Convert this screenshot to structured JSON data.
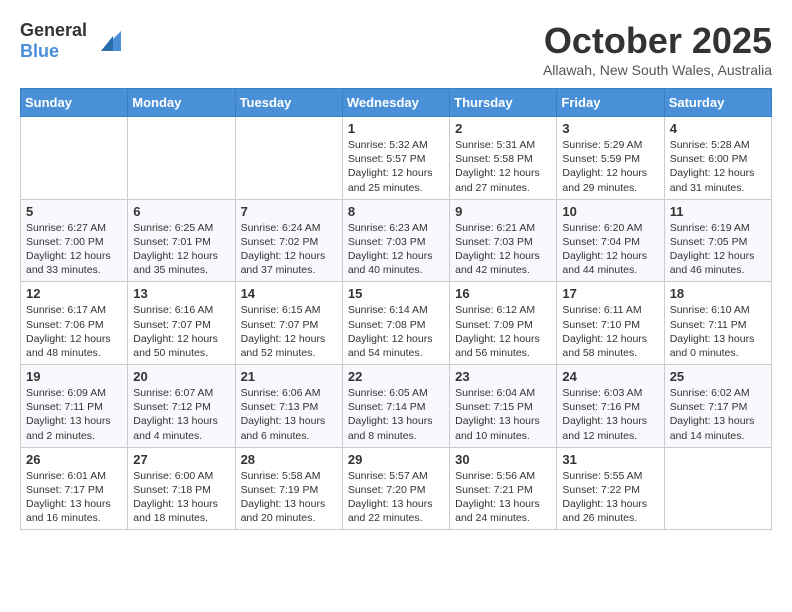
{
  "header": {
    "logo": {
      "text_general": "General",
      "text_blue": "Blue"
    },
    "title": "October 2025",
    "subtitle": "Allawah, New South Wales, Australia"
  },
  "calendar": {
    "weekdays": [
      "Sunday",
      "Monday",
      "Tuesday",
      "Wednesday",
      "Thursday",
      "Friday",
      "Saturday"
    ],
    "weeks": [
      [
        {
          "day": "",
          "info": ""
        },
        {
          "day": "",
          "info": ""
        },
        {
          "day": "",
          "info": ""
        },
        {
          "day": "1",
          "info": "Sunrise: 5:32 AM\nSunset: 5:57 PM\nDaylight: 12 hours\nand 25 minutes."
        },
        {
          "day": "2",
          "info": "Sunrise: 5:31 AM\nSunset: 5:58 PM\nDaylight: 12 hours\nand 27 minutes."
        },
        {
          "day": "3",
          "info": "Sunrise: 5:29 AM\nSunset: 5:59 PM\nDaylight: 12 hours\nand 29 minutes."
        },
        {
          "day": "4",
          "info": "Sunrise: 5:28 AM\nSunset: 6:00 PM\nDaylight: 12 hours\nand 31 minutes."
        }
      ],
      [
        {
          "day": "5",
          "info": "Sunrise: 6:27 AM\nSunset: 7:00 PM\nDaylight: 12 hours\nand 33 minutes."
        },
        {
          "day": "6",
          "info": "Sunrise: 6:25 AM\nSunset: 7:01 PM\nDaylight: 12 hours\nand 35 minutes."
        },
        {
          "day": "7",
          "info": "Sunrise: 6:24 AM\nSunset: 7:02 PM\nDaylight: 12 hours\nand 37 minutes."
        },
        {
          "day": "8",
          "info": "Sunrise: 6:23 AM\nSunset: 7:03 PM\nDaylight: 12 hours\nand 40 minutes."
        },
        {
          "day": "9",
          "info": "Sunrise: 6:21 AM\nSunset: 7:03 PM\nDaylight: 12 hours\nand 42 minutes."
        },
        {
          "day": "10",
          "info": "Sunrise: 6:20 AM\nSunset: 7:04 PM\nDaylight: 12 hours\nand 44 minutes."
        },
        {
          "day": "11",
          "info": "Sunrise: 6:19 AM\nSunset: 7:05 PM\nDaylight: 12 hours\nand 46 minutes."
        }
      ],
      [
        {
          "day": "12",
          "info": "Sunrise: 6:17 AM\nSunset: 7:06 PM\nDaylight: 12 hours\nand 48 minutes."
        },
        {
          "day": "13",
          "info": "Sunrise: 6:16 AM\nSunset: 7:07 PM\nDaylight: 12 hours\nand 50 minutes."
        },
        {
          "day": "14",
          "info": "Sunrise: 6:15 AM\nSunset: 7:07 PM\nDaylight: 12 hours\nand 52 minutes."
        },
        {
          "day": "15",
          "info": "Sunrise: 6:14 AM\nSunset: 7:08 PM\nDaylight: 12 hours\nand 54 minutes."
        },
        {
          "day": "16",
          "info": "Sunrise: 6:12 AM\nSunset: 7:09 PM\nDaylight: 12 hours\nand 56 minutes."
        },
        {
          "day": "17",
          "info": "Sunrise: 6:11 AM\nSunset: 7:10 PM\nDaylight: 12 hours\nand 58 minutes."
        },
        {
          "day": "18",
          "info": "Sunrise: 6:10 AM\nSunset: 7:11 PM\nDaylight: 13 hours\nand 0 minutes."
        }
      ],
      [
        {
          "day": "19",
          "info": "Sunrise: 6:09 AM\nSunset: 7:11 PM\nDaylight: 13 hours\nand 2 minutes."
        },
        {
          "day": "20",
          "info": "Sunrise: 6:07 AM\nSunset: 7:12 PM\nDaylight: 13 hours\nand 4 minutes."
        },
        {
          "day": "21",
          "info": "Sunrise: 6:06 AM\nSunset: 7:13 PM\nDaylight: 13 hours\nand 6 minutes."
        },
        {
          "day": "22",
          "info": "Sunrise: 6:05 AM\nSunset: 7:14 PM\nDaylight: 13 hours\nand 8 minutes."
        },
        {
          "day": "23",
          "info": "Sunrise: 6:04 AM\nSunset: 7:15 PM\nDaylight: 13 hours\nand 10 minutes."
        },
        {
          "day": "24",
          "info": "Sunrise: 6:03 AM\nSunset: 7:16 PM\nDaylight: 13 hours\nand 12 minutes."
        },
        {
          "day": "25",
          "info": "Sunrise: 6:02 AM\nSunset: 7:17 PM\nDaylight: 13 hours\nand 14 minutes."
        }
      ],
      [
        {
          "day": "26",
          "info": "Sunrise: 6:01 AM\nSunset: 7:17 PM\nDaylight: 13 hours\nand 16 minutes."
        },
        {
          "day": "27",
          "info": "Sunrise: 6:00 AM\nSunset: 7:18 PM\nDaylight: 13 hours\nand 18 minutes."
        },
        {
          "day": "28",
          "info": "Sunrise: 5:58 AM\nSunset: 7:19 PM\nDaylight: 13 hours\nand 20 minutes."
        },
        {
          "day": "29",
          "info": "Sunrise: 5:57 AM\nSunset: 7:20 PM\nDaylight: 13 hours\nand 22 minutes."
        },
        {
          "day": "30",
          "info": "Sunrise: 5:56 AM\nSunset: 7:21 PM\nDaylight: 13 hours\nand 24 minutes."
        },
        {
          "day": "31",
          "info": "Sunrise: 5:55 AM\nSunset: 7:22 PM\nDaylight: 13 hours\nand 26 minutes."
        },
        {
          "day": "",
          "info": ""
        }
      ]
    ]
  }
}
